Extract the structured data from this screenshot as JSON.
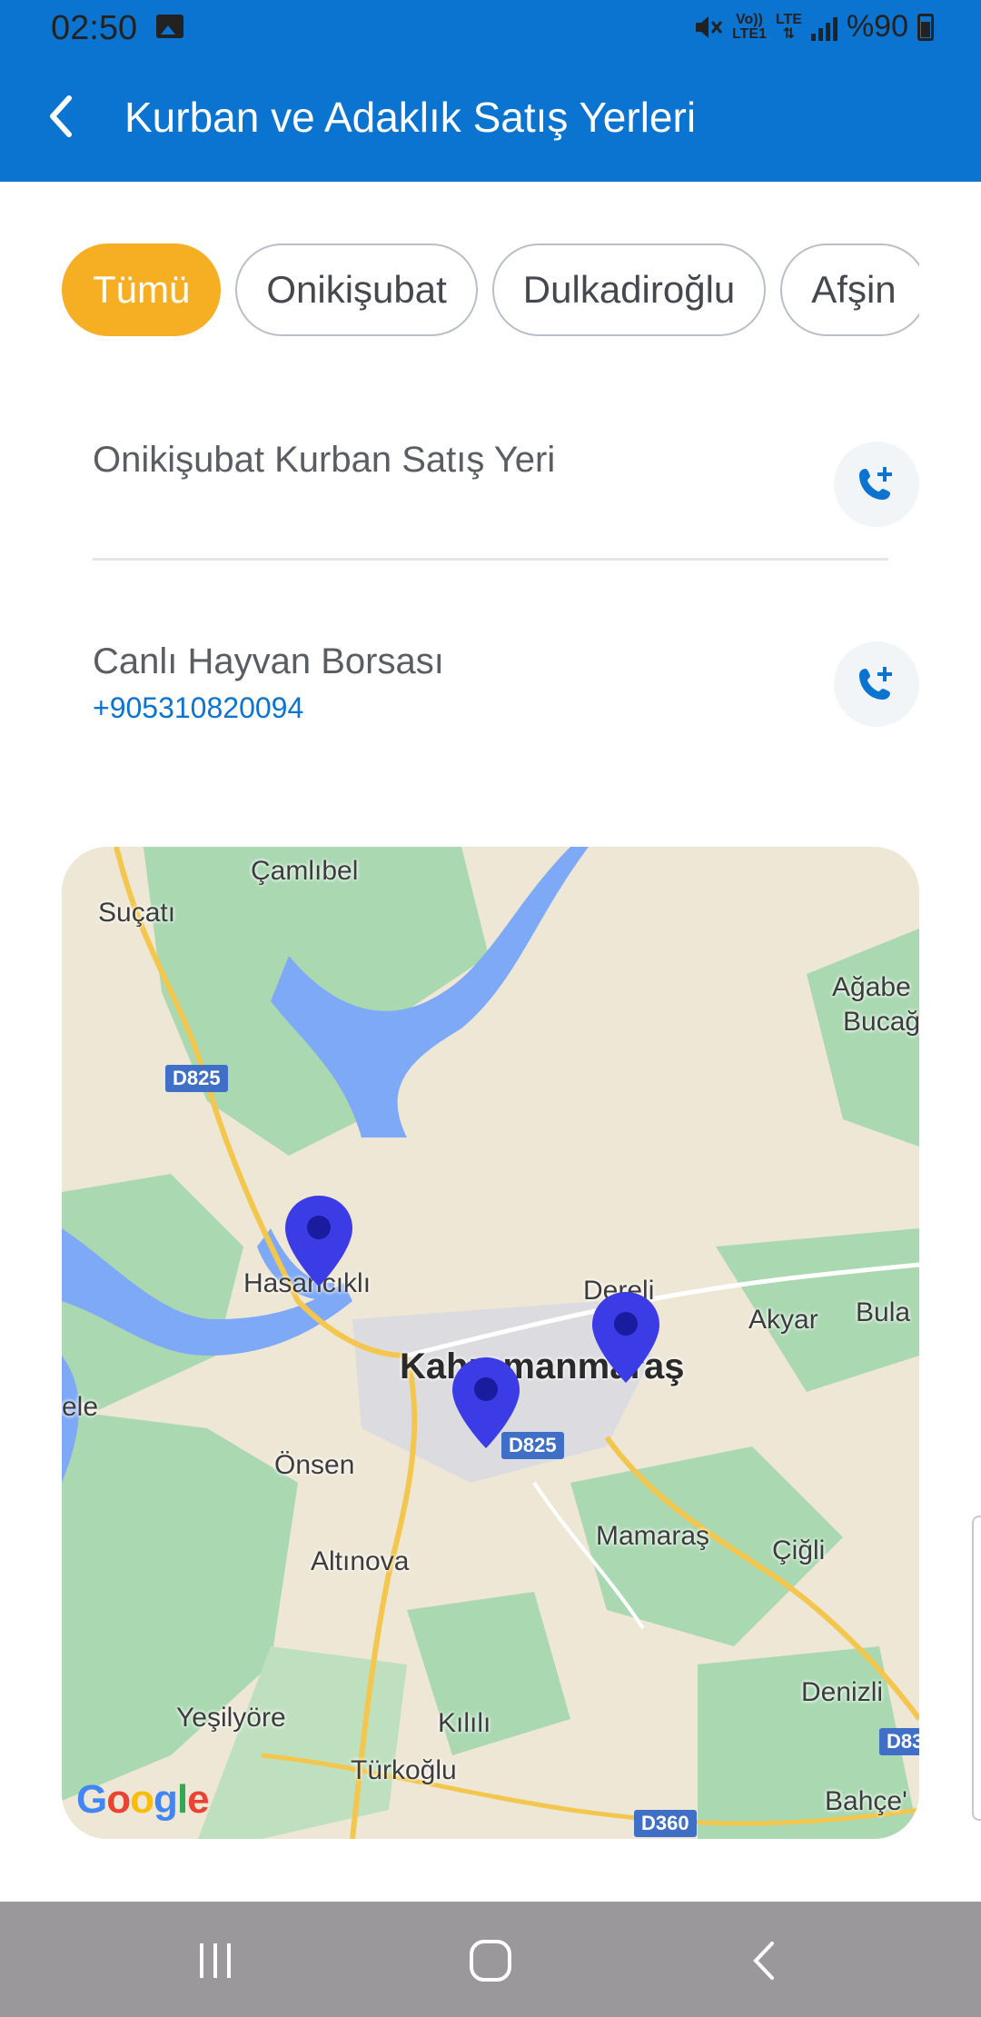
{
  "status_bar": {
    "time": "02:50",
    "network_top": "Vo))",
    "network_bottom": "LTE1",
    "lte_label": "LTE",
    "battery": "%90"
  },
  "app_bar": {
    "title": "Kurban ve Adaklık Satış Yerleri"
  },
  "filters": {
    "chips": [
      {
        "label": "Tümü",
        "active": true
      },
      {
        "label": "Onikişubat",
        "active": false
      },
      {
        "label": "Dulkadiroğlu",
        "active": false
      },
      {
        "label": "Afşin",
        "active": false
      }
    ]
  },
  "places": [
    {
      "name": "Onikişubat Kurban Satış Yeri",
      "phone": ""
    },
    {
      "name": "Canlı Hayvan Borsası",
      "phone": "+905310820094"
    }
  ],
  "map": {
    "labels": {
      "camlibel": "Çamlıbel",
      "sucati": "Suçatı",
      "agabey": "Ağabe",
      "bucag": "Bucağ",
      "hasancikli": "Hasancıklı",
      "dereli": "Dereli",
      "akyar": "Akyar",
      "bula": "Bula",
      "kahramanmaras": "Kahramanmaraş",
      "ele": "ele",
      "onsen": "Önsen",
      "mamaras": "Mamaraş",
      "cigli": "Çiğli",
      "altinova": "Altınova",
      "denizli": "Denizli",
      "yesilyore": "Yeşilyöre",
      "kilili": "Kılılı",
      "turkoglu": "Türkoğlu",
      "bahce": "Bahçe'"
    },
    "roads": {
      "d825_top": "D825",
      "d825_mid": "D825",
      "d360": "D360",
      "d83": "D83"
    },
    "attribution": "Google",
    "colors": {
      "land": "#eee7d6",
      "forest": "#a9d8b1",
      "water": "#7ea9f6",
      "pin": "#3b3ce6"
    }
  },
  "colors": {
    "primary": "#0b74d1",
    "accent": "#f6ae23"
  }
}
